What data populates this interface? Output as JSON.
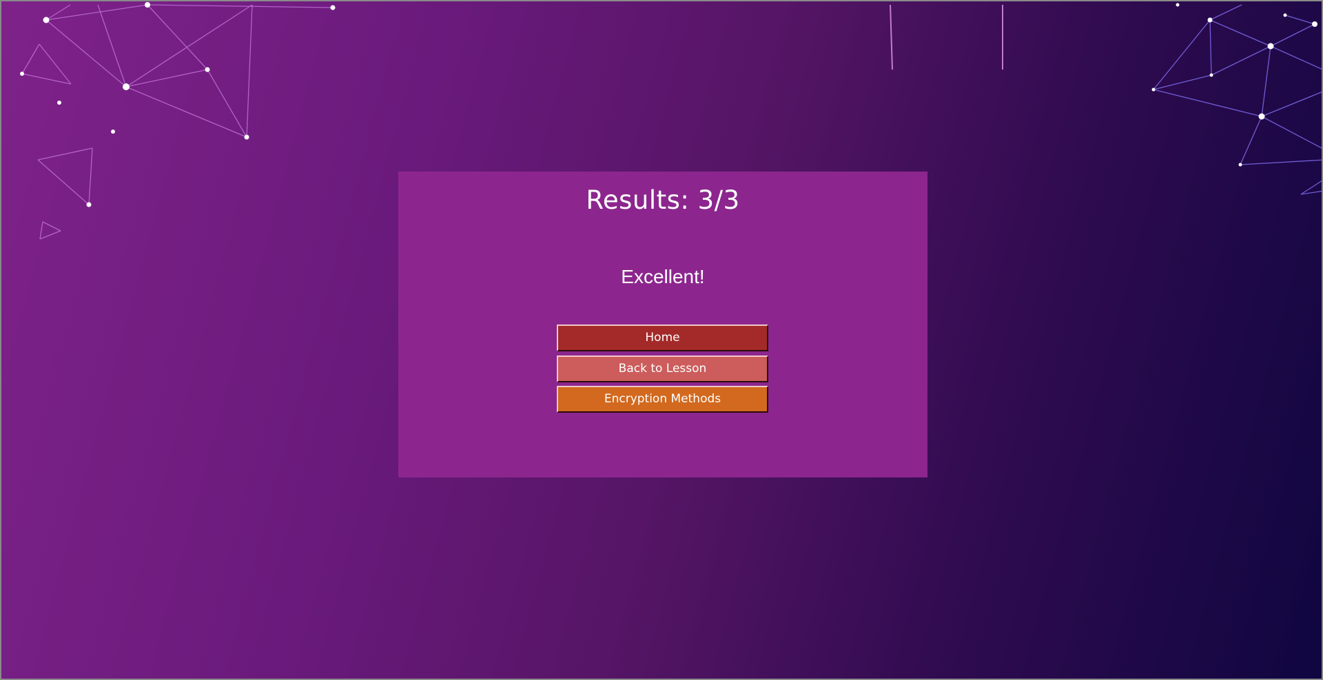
{
  "results": {
    "title": "Results: 3/3",
    "message": "Excellent!"
  },
  "buttons": {
    "home": "Home",
    "back_to_lesson": "Back to Lesson",
    "encryption_methods": "Encryption Methods"
  },
  "colors": {
    "panel": "#8c268e",
    "home_button": "#a42a2a",
    "back_to_lesson_button": "#cc5d5c",
    "encryption_methods_button": "#d2691e"
  }
}
